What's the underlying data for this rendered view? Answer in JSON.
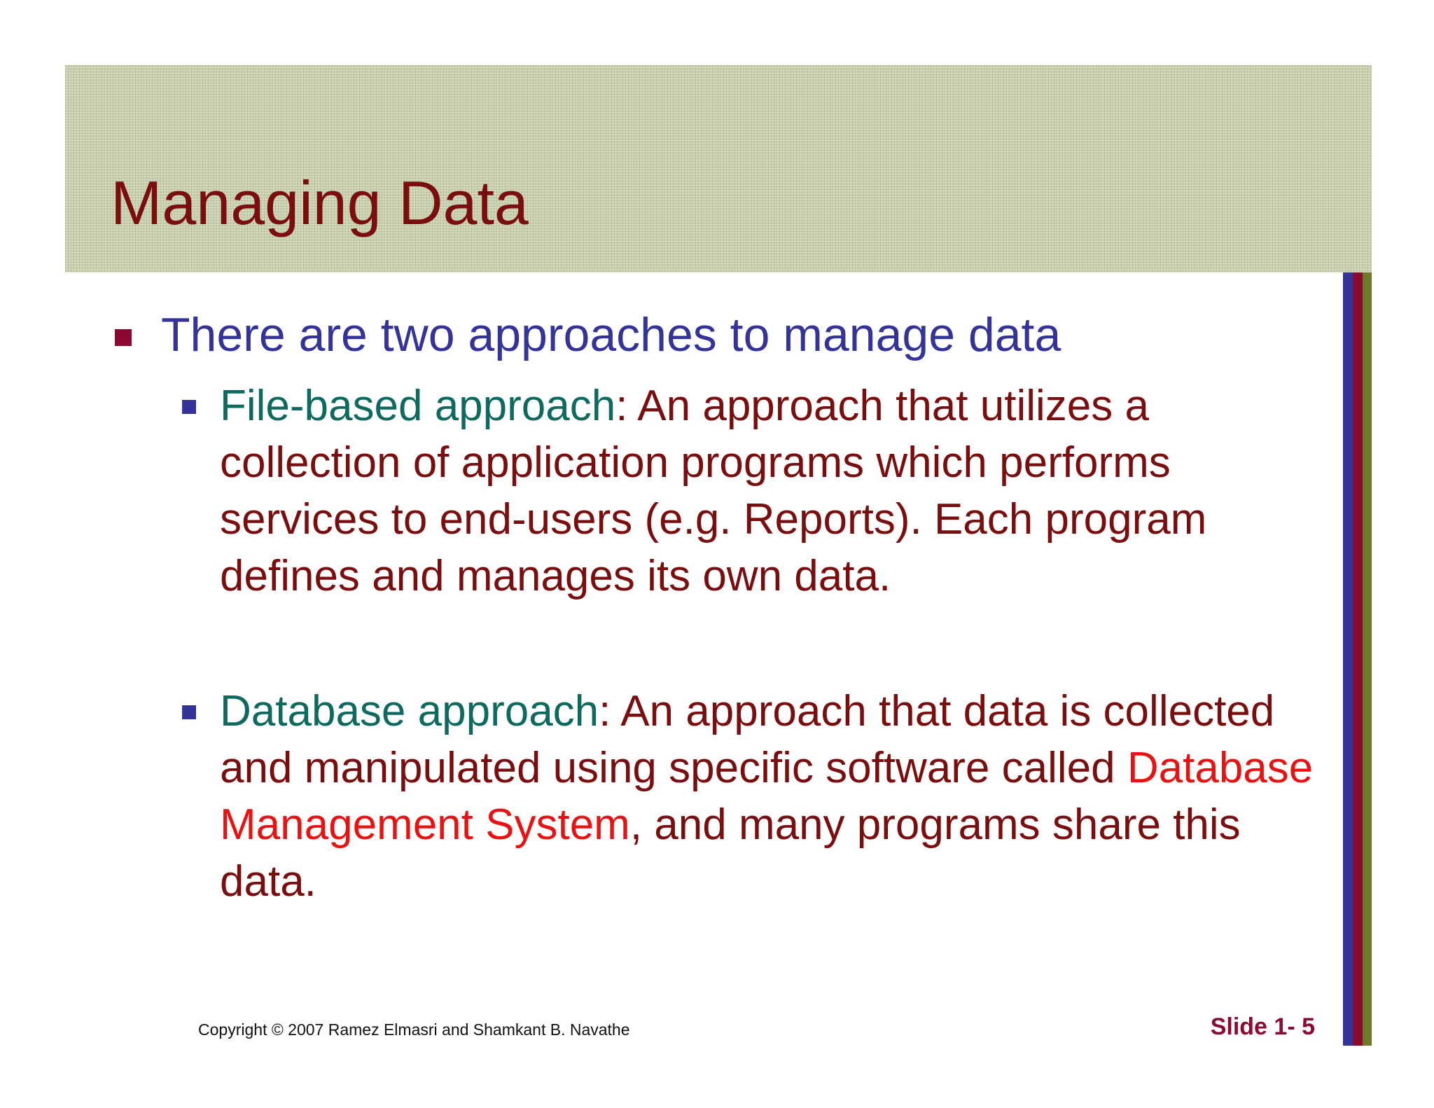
{
  "slide": {
    "title": "Managing Data",
    "main_bullet": "There are two approaches to manage data",
    "sub_bullets": [
      {
        "term": "File-based approach",
        "text": ": An approach that utilizes a collection of application programs which performs services to end-users (e.g. Reports). Each program defines and manages its own data."
      },
      {
        "term": "Database approach",
        "text_before": ": An approach that data is collected and manipulated using specific software called ",
        "highlight": "Database Management System",
        "text_after": ", and many programs share this data."
      }
    ],
    "copyright": "Copyright © 2007 Ramez Elmasri and Shamkant B. Navathe",
    "slide_number": "Slide 1- 5"
  },
  "colors": {
    "title": "#7a0e0e",
    "main_bullet_text": "#333399",
    "body_text": "#7a0e0e",
    "term": "#0e6a5e",
    "highlight": "#e81212",
    "accent_red": "#8c0a30",
    "accent_blue": "#333399",
    "accent_olive": "#6e7a2a",
    "title_band": "#c8cfae"
  }
}
